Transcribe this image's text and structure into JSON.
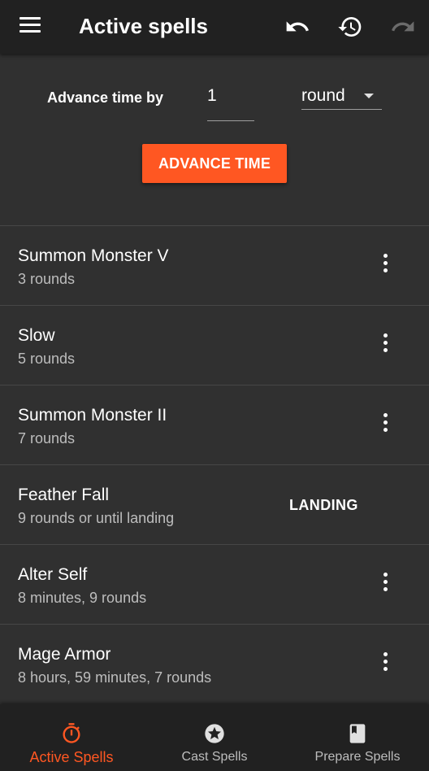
{
  "appbar": {
    "title": "Active spells",
    "icons": [
      "menu-icon",
      "undo-icon",
      "history-icon",
      "redo-icon"
    ]
  },
  "controls": {
    "advance_label": "Advance time by",
    "amount_value": "1",
    "unit_value": "round",
    "advance_button": "ADVANCE TIME"
  },
  "spells": [
    {
      "name": "Summon Monster V",
      "duration": "3 rounds",
      "action": "more"
    },
    {
      "name": "Slow",
      "duration": "5 rounds",
      "action": "more"
    },
    {
      "name": "Summon Monster II",
      "duration": "7 rounds",
      "action": "more"
    },
    {
      "name": "Feather Fall",
      "duration": "9 rounds or until landing",
      "action": "LANDING"
    },
    {
      "name": "Alter Self",
      "duration": "8 minutes, 9 rounds",
      "action": "more"
    },
    {
      "name": "Mage Armor",
      "duration": "8 hours, 59 minutes, 7 rounds",
      "action": "more"
    }
  ],
  "bottom_nav": [
    {
      "label": "Active Spells",
      "icon": "timer-icon",
      "active": true
    },
    {
      "label": "Cast Spells",
      "icon": "star-icon",
      "active": false
    },
    {
      "label": "Prepare Spells",
      "icon": "book-icon",
      "active": false
    }
  ],
  "colors": {
    "accent": "#ff5722",
    "appbar": "#212121",
    "background": "#303030",
    "secondary_text": "#bdbdbd"
  }
}
